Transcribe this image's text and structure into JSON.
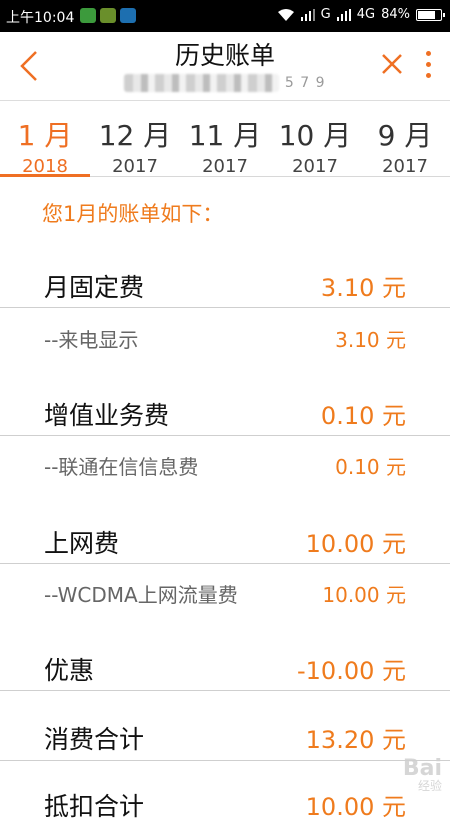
{
  "status_bar": {
    "time": "上午10:04",
    "network": "G",
    "network2": "4G",
    "battery": "84%",
    "battery_level": 0.84
  },
  "header": {
    "title": "历史账单",
    "subtitle_visible": "5 7 9"
  },
  "tabs": [
    {
      "month": "1 月",
      "year": "2018",
      "active": true
    },
    {
      "month": "12 月",
      "year": "2017",
      "active": false
    },
    {
      "month": "11 月",
      "year": "2017",
      "active": false
    },
    {
      "month": "10 月",
      "year": "2017",
      "active": false
    },
    {
      "month": "9 月",
      "year": "2017",
      "active": false
    }
  ],
  "bill": {
    "intro": "您1月的账单如下：",
    "items": [
      {
        "label": "月固定费",
        "amount": "3.10 元"
      },
      {
        "label": "--来电显示",
        "amount": "3.10 元"
      },
      {
        "label": "增值业务费",
        "amount": "0.10 元"
      },
      {
        "label": "--联通在信信息费",
        "amount": "0.10 元"
      },
      {
        "label": "上网费",
        "amount": "10.00 元"
      },
      {
        "label": "--WCDMA上网流量费",
        "amount": "10.00 元"
      },
      {
        "label": "优惠",
        "amount": "-10.00 元"
      },
      {
        "label": "消费合计",
        "amount": "13.20 元"
      },
      {
        "label": "抵扣合计",
        "amount": "10.00 元"
      }
    ]
  },
  "watermark": {
    "text": "Bai",
    "sub": "经验"
  },
  "colors": {
    "accent": "#ef6f23",
    "amount": "#ef7b1d"
  }
}
